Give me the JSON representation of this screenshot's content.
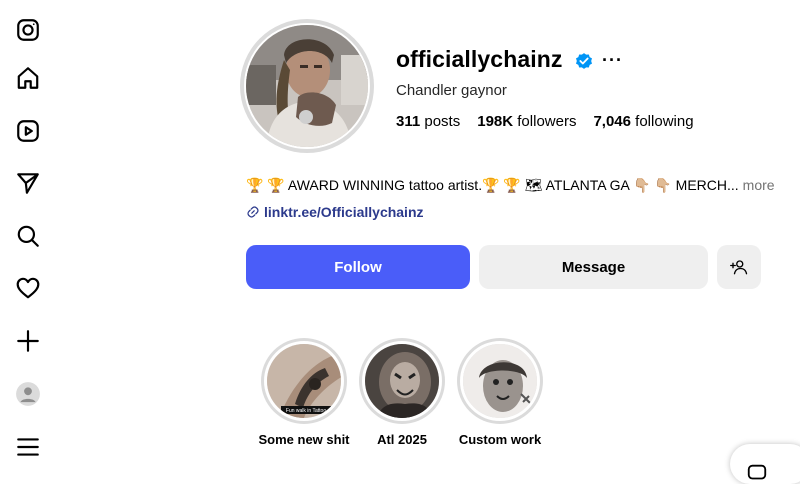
{
  "nav": {
    "items": [
      {
        "icon": "instagram-icon"
      },
      {
        "icon": "home-icon"
      },
      {
        "icon": "reels-icon"
      },
      {
        "icon": "messages-icon"
      },
      {
        "icon": "search-icon"
      },
      {
        "icon": "heart-icon"
      },
      {
        "icon": "create-icon"
      },
      {
        "icon": "profile-avatar-icon"
      },
      {
        "icon": "menu-icon"
      }
    ]
  },
  "profile": {
    "username": "officiallychainz",
    "more": "···",
    "full_name": "Chandler gaynor",
    "posts_count": "311",
    "posts_label": "posts",
    "followers_count": "198K",
    "followers_label": "followers",
    "following_count": "7,046",
    "following_label": "following",
    "bio": "🏆 🏆 AWARD WINNING tattoo artist.🏆 🏆 🗺 ATLANTA GA 👇🏼 👇🏼 MERCH...",
    "bio_more": "more",
    "link": "linktr.ee/Officiallychainz"
  },
  "actions": {
    "follow": "Follow",
    "message": "Message"
  },
  "highlights": [
    {
      "label": "Some new shit",
      "inner_caption": "Fun walk in Tattoo"
    },
    {
      "label": "Atl 2025"
    },
    {
      "label": "Custom work"
    }
  ],
  "colors": {
    "follow_bg": "#4a5df9",
    "secondary_bg": "#efefef",
    "verified": "#0095f6",
    "link": "#2c3a8c"
  }
}
